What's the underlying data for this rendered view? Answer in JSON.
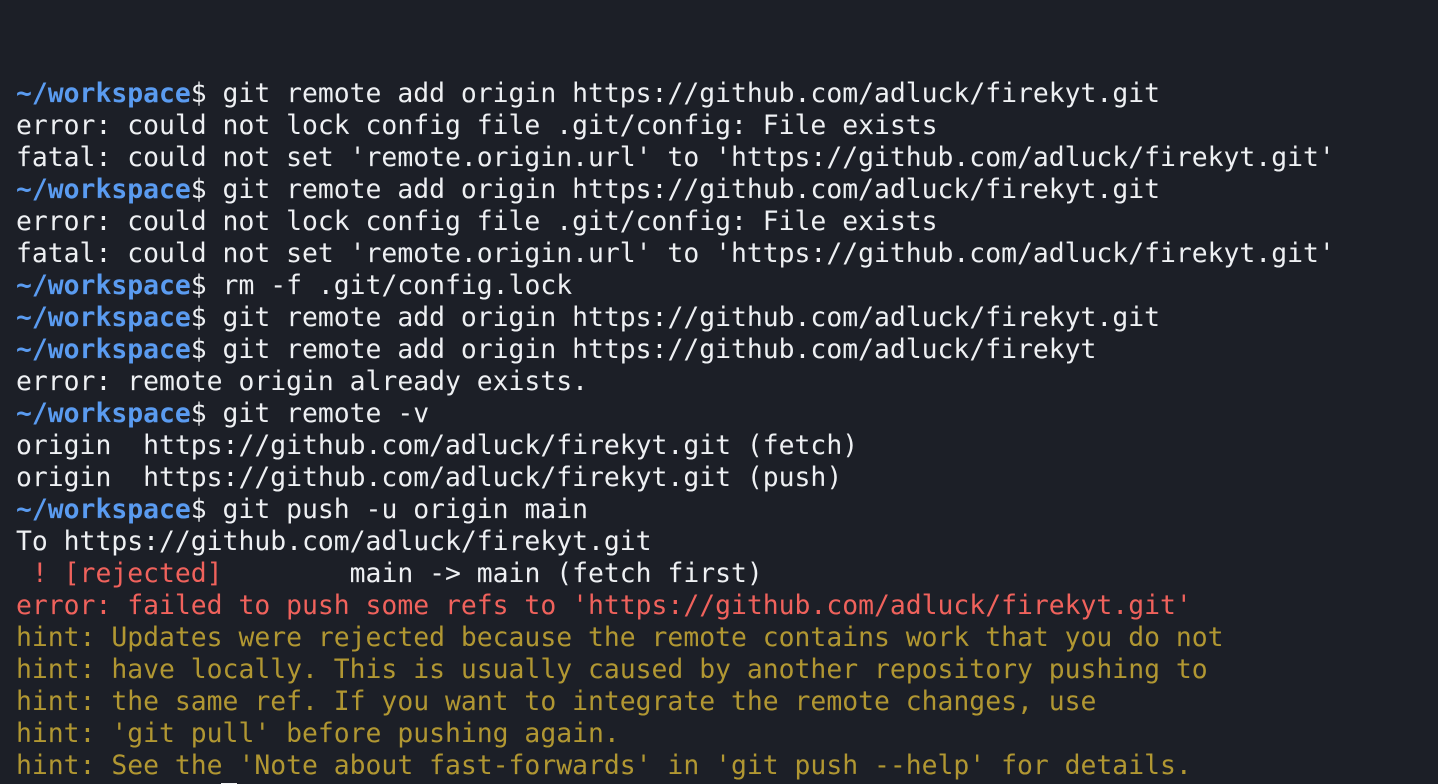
{
  "terminal": {
    "prompt": "~/workspace",
    "dollar": "$",
    "colors": {
      "background": "#1c1f27",
      "text": "#eef0f3",
      "prompt": "#5a9bf0",
      "error": "#f0625c",
      "hint": "#b19732"
    },
    "lines": [
      {
        "type": "cmd",
        "text": " git remote add origin https://github.com/adluck/firekyt.git"
      },
      {
        "type": "out",
        "text": "error: could not lock config file .git/config: File exists"
      },
      {
        "type": "out",
        "text": "fatal: could not set 'remote.origin.url' to 'https://github.com/adluck/firekyt.git'"
      },
      {
        "type": "cmd",
        "text": " git remote add origin https://github.com/adluck/firekyt.git"
      },
      {
        "type": "out",
        "text": "error: could not lock config file .git/config: File exists"
      },
      {
        "type": "out",
        "text": "fatal: could not set 'remote.origin.url' to 'https://github.com/adluck/firekyt.git'"
      },
      {
        "type": "cmd",
        "text": " rm -f .git/config.lock"
      },
      {
        "type": "cmd",
        "text": " git remote add origin https://github.com/adluck/firekyt.git"
      },
      {
        "type": "cmd",
        "text": " git remote add origin https://github.com/adluck/firekyt"
      },
      {
        "type": "out",
        "text": "error: remote origin already exists."
      },
      {
        "type": "cmd",
        "text": " git remote -v"
      },
      {
        "type": "out",
        "text": "origin  https://github.com/adluck/firekyt.git (fetch)"
      },
      {
        "type": "out",
        "text": "origin  https://github.com/adluck/firekyt.git (push)"
      },
      {
        "type": "cmd",
        "text": " git push -u origin main"
      },
      {
        "type": "out",
        "text": "To https://github.com/adluck/firekyt.git"
      },
      {
        "type": "rejected",
        "red": " ! [rejected]",
        "rest": "        main -> main (fetch first)"
      },
      {
        "type": "err",
        "text": "error: failed to push some refs to 'https://github.com/adluck/firekyt.git'"
      },
      {
        "type": "hint",
        "text": "hint: Updates were rejected because the remote contains work that you do not"
      },
      {
        "type": "hint",
        "text": "hint: have locally. This is usually caused by another repository pushing to"
      },
      {
        "type": "hint",
        "text": "hint: the same ref. If you want to integrate the remote changes, use"
      },
      {
        "type": "hint",
        "text": "hint: 'git pull' before pushing again."
      },
      {
        "type": "hint",
        "text": "hint: See the 'Note about fast-forwards' in 'git push --help' for details."
      },
      {
        "type": "prompt-active",
        "text": ""
      }
    ]
  }
}
